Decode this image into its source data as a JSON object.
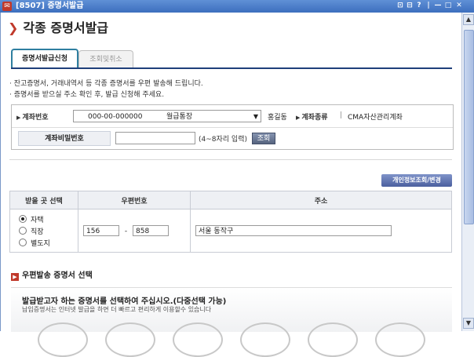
{
  "window": {
    "title": "[8507] 증명서발급",
    "buttons": [
      "⊡",
      "⊟",
      "?",
      "|",
      "—",
      "□",
      "✕"
    ]
  },
  "page": {
    "title": "각종 증명서발급"
  },
  "tabs": [
    {
      "label": "증명서발급신청",
      "active": true
    },
    {
      "label": "조회및취소",
      "active": false
    }
  ],
  "description": [
    "· 잔고증명서, 거래내역서 등 각종 증명서를 우편 발송해 드립니다.",
    "· 증명서를 받으실 주소 확인 후, 발급 신청해 주세요."
  ],
  "account": {
    "label": "계좌번호",
    "number": "000-00-000000",
    "name_type": "월급통장",
    "owner": "홍길동",
    "type_label": "계좌종류",
    "type_sep": "|",
    "type_value": "CMA자산관리계좌"
  },
  "password": {
    "label": "계좌비밀번호",
    "value": "",
    "hint": "(4~8자리 입력)",
    "button": "조회"
  },
  "personal_info_button": "개인정보조회/변경",
  "address_table": {
    "headers": [
      "받을 곳 선택",
      "우편번호",
      "주소"
    ],
    "options": [
      {
        "label": "자택",
        "checked": true
      },
      {
        "label": "직장",
        "checked": false
      },
      {
        "label": "별도지",
        "checked": false
      }
    ],
    "zip1": "156",
    "zip_sep": "-",
    "zip2": "858",
    "address": "서울 동작구"
  },
  "section": {
    "icon": "red-square-icon",
    "title": "우편발송 증명서 선택"
  },
  "panel": {
    "heading": "발급받고자 하는 증명서를 선택하여 주십시오.(다중선택 가능)",
    "sub": "납입증명서는 인터넷 발급을 하면 더 빠르고 편리하게 이용할수 있습니다"
  },
  "colors": {
    "titlebar": "#3d6fbe",
    "accent_red": "#c0392b",
    "tab_border": "#2f7fa0",
    "tab_line": "#1f3f7a"
  }
}
